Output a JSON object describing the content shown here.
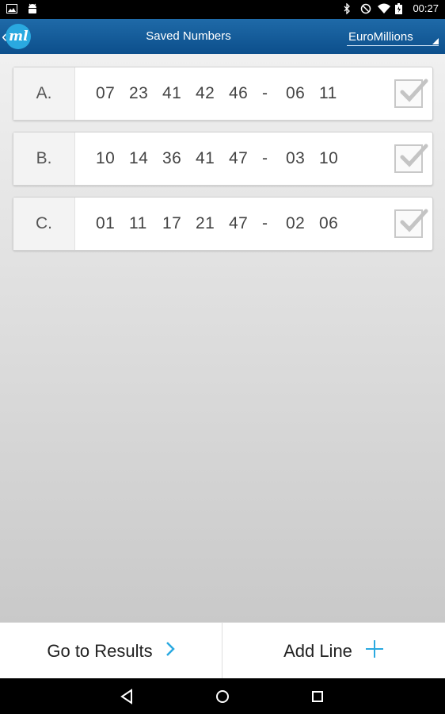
{
  "status": {
    "time": "00:27"
  },
  "appbar": {
    "logo_text": "ml",
    "title": "Saved Numbers",
    "game_select": "EuroMillions"
  },
  "lines": [
    {
      "label": "A.",
      "numbers": [
        "07",
        "23",
        "41",
        "42",
        "46"
      ],
      "sep": "-",
      "stars": [
        "06",
        "11"
      ],
      "checked": true
    },
    {
      "label": "B.",
      "numbers": [
        "10",
        "14",
        "36",
        "41",
        "47"
      ],
      "sep": "-",
      "stars": [
        "03",
        "10"
      ],
      "checked": true
    },
    {
      "label": "C.",
      "numbers": [
        "01",
        "11",
        "17",
        "21",
        "47"
      ],
      "sep": "-",
      "stars": [
        "02",
        "06"
      ],
      "checked": true
    }
  ],
  "bottom": {
    "results_label": "Go to Results",
    "add_label": "Add Line"
  },
  "icons": {
    "status_left": [
      "image-notification-icon",
      "android-notification-icon"
    ],
    "status_right": [
      "bluetooth-icon",
      "do-not-disturb-icon",
      "wifi-icon",
      "battery-icon"
    ],
    "nav": [
      "back-icon",
      "home-icon",
      "recents-icon"
    ]
  },
  "colors": {
    "appbar": "#0c4f8c",
    "accent": "#2aa9e0"
  }
}
